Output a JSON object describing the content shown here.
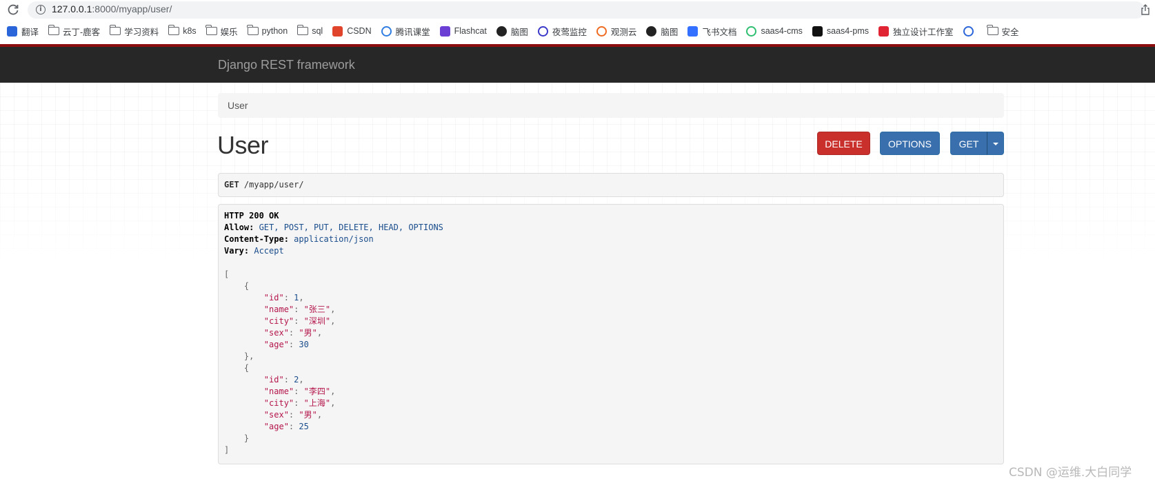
{
  "browser": {
    "url_host": "127.0.0.1",
    "url_rest": ":8000/myapp/user/",
    "bookmarks": [
      {
        "label": "翻译",
        "icon": "translate-icon",
        "color": "#2a66d9"
      },
      {
        "label": "云丁-鹿客",
        "icon": "folder-icon"
      },
      {
        "label": "学习资料",
        "icon": "folder-icon"
      },
      {
        "label": "k8s",
        "icon": "folder-icon"
      },
      {
        "label": "娱乐",
        "icon": "folder-icon"
      },
      {
        "label": "python",
        "icon": "folder-icon"
      },
      {
        "label": "sql",
        "icon": "folder-icon"
      },
      {
        "label": "CSDN",
        "icon": "csdn-icon",
        "color": "#e0442b"
      },
      {
        "label": "腾讯课堂",
        "icon": "tencent-class-icon",
        "color": "#2f7de1"
      },
      {
        "label": "Flashcat",
        "icon": "flashcat-icon",
        "color": "#6b3fd4"
      },
      {
        "label": "脑图",
        "icon": "mindmap-owl-icon",
        "color": "#222222"
      },
      {
        "label": "夜莺监控",
        "icon": "nightingale-icon",
        "color": "#3b39c9"
      },
      {
        "label": "观测云",
        "icon": "guance-icon",
        "color": "#f06b22"
      },
      {
        "label": "脑图",
        "icon": "mindmap-owl-icon",
        "color": "#222222"
      },
      {
        "label": "飞书文档",
        "icon": "feishu-doc-icon",
        "color": "#3370ff"
      },
      {
        "label": "saas4-cms",
        "icon": "saas-cms-icon",
        "color": "#2fbf71"
      },
      {
        "label": "saas4-pms",
        "icon": "saas-pms-icon",
        "color": "#111111"
      },
      {
        "label": "独立设计工作室",
        "icon": "studio-icon",
        "color": "#e02433"
      },
      {
        "label": "",
        "icon": "link-icon",
        "color": "#2a66d9"
      },
      {
        "label": "安全",
        "icon": "folder-icon"
      }
    ]
  },
  "navbar": {
    "brand": "Django REST framework"
  },
  "breadcrumb": {
    "current": "User"
  },
  "page": {
    "title": "User",
    "buttons": {
      "delete": "DELETE",
      "options": "OPTIONS",
      "get": "GET"
    }
  },
  "request": {
    "method": "GET",
    "path": " /myapp/user/"
  },
  "response": {
    "status": "HTTP 200 OK",
    "headers": [
      {
        "key": "Allow:",
        "value": " GET, POST, PUT, DELETE, HEAD, OPTIONS"
      },
      {
        "key": "Content-Type:",
        "value": " application/json"
      },
      {
        "key": "Vary:",
        "value": " Accept"
      }
    ],
    "body": [
      {
        "id": 1,
        "name": "张三",
        "city": "深圳",
        "sex": "男",
        "age": 30
      },
      {
        "id": 2,
        "name": "李四",
        "city": "上海",
        "sex": "男",
        "age": 25
      }
    ]
  },
  "watermark": "CSDN @运维.大白同学",
  "colors": {
    "navbar_bg": "#272727",
    "navbar_accent": "#8b0d0d",
    "delete_btn": "#c9302c",
    "primary_btn": "#3a6fad"
  }
}
